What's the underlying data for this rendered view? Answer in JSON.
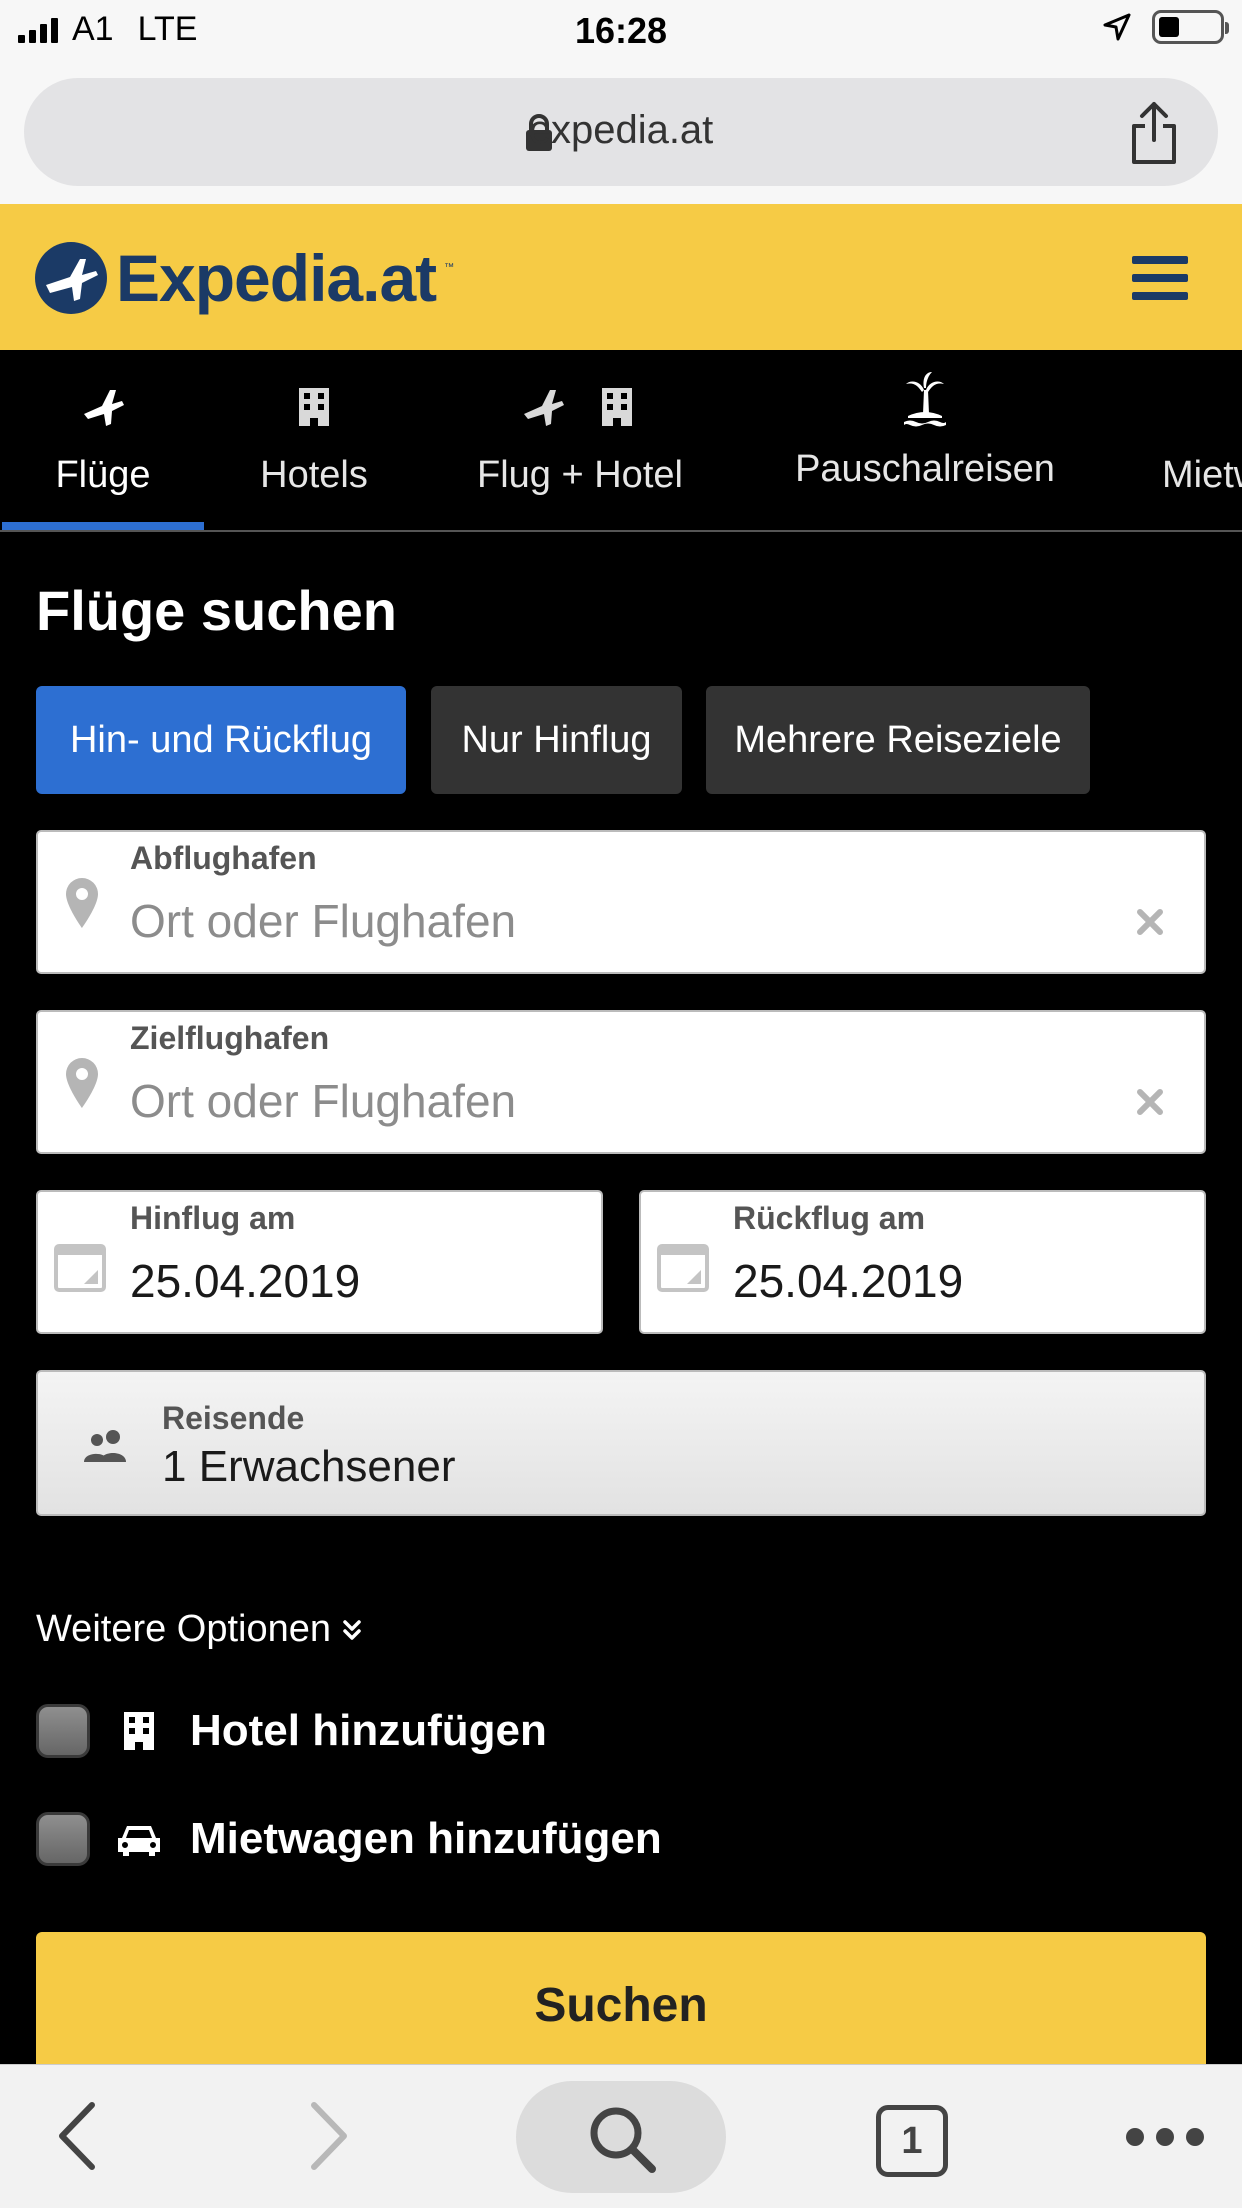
{
  "status_bar": {
    "carrier": "A1",
    "network": "LTE",
    "time": "16:28"
  },
  "browser": {
    "url": "expedia.at",
    "open_tabs": "1"
  },
  "header": {
    "logo_text": "Expedia.at",
    "logo_tm": "™",
    "brand_color": "#f6cb45"
  },
  "tabs": [
    {
      "label": "Flüge",
      "icon": "plane-icon",
      "active": true
    },
    {
      "label": "Hotels",
      "icon": "hotel-icon",
      "active": false
    },
    {
      "label": "Flug + Hotel",
      "icon": "plane-hotel-icon",
      "active": false
    },
    {
      "label": "Pauschalreisen",
      "icon": "palm-island-icon",
      "active": false
    },
    {
      "label": "Mietw",
      "icon": "car-icon",
      "active": false
    }
  ],
  "form": {
    "title": "Flüge suchen",
    "trip_types": [
      "Hin- und Rückflug",
      "Nur Hinflug",
      "Mehrere Reiseziele"
    ],
    "selected_trip_type": "Hin- und Rückflug",
    "origin": {
      "label": "Abflughafen",
      "placeholder": "Ort oder Flughafen"
    },
    "destination": {
      "label": "Zielflughafen",
      "placeholder": "Ort oder Flughafen"
    },
    "departure": {
      "label": "Hinflug am",
      "value": "25.04.2019"
    },
    "return": {
      "label": "Rückflug am",
      "value": "25.04.2019"
    },
    "travelers": {
      "label": "Reisende",
      "value": "1 Erwachsener"
    },
    "more_options": "Weitere Optionen",
    "add_hotel": "Hotel hinzufügen",
    "add_car": "Mietwagen hinzufügen",
    "search_button": "Suchen",
    "accent_color": "#2d6fd2"
  }
}
